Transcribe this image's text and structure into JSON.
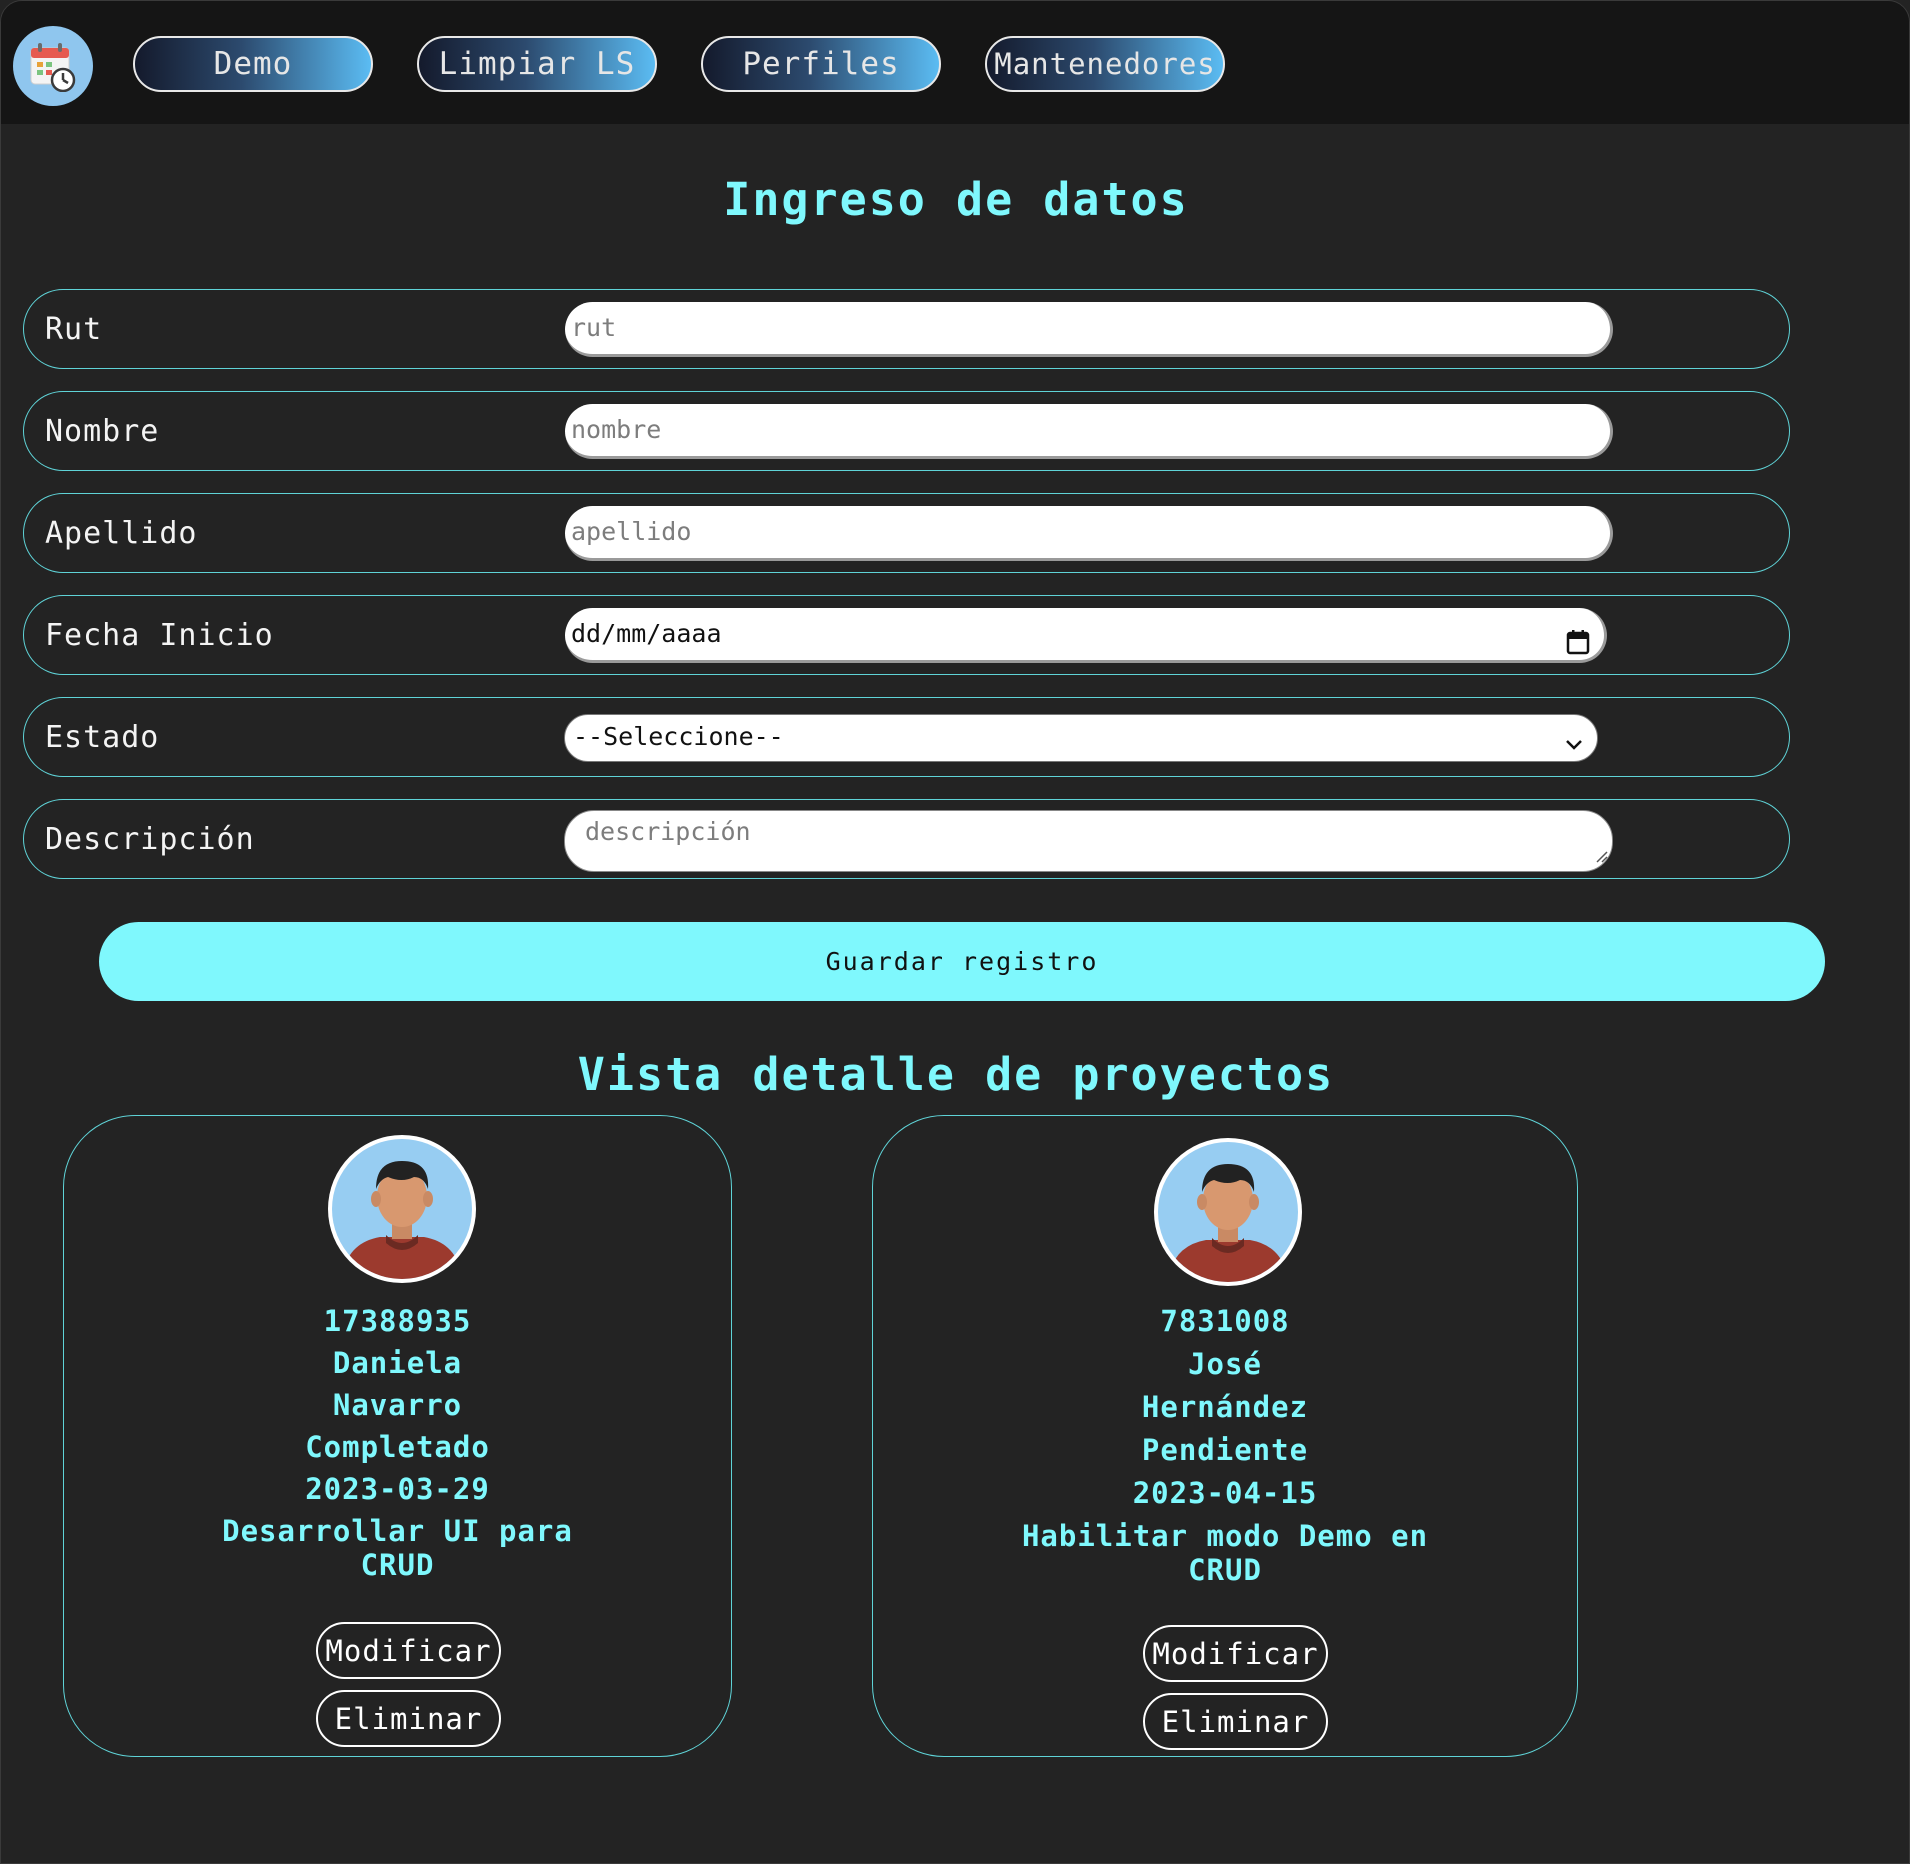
{
  "nav": {
    "items": [
      {
        "label": "Demo"
      },
      {
        "label": "Limpiar LS"
      },
      {
        "label": "Perfiles"
      },
      {
        "label": "Mantenedores"
      }
    ]
  },
  "form": {
    "title": "Ingreso de datos",
    "rut": {
      "label": "Rut",
      "placeholder": "rut"
    },
    "nombre": {
      "label": "Nombre",
      "placeholder": "nombre"
    },
    "apellido": {
      "label": "Apellido",
      "placeholder": "apellido"
    },
    "fecha": {
      "label": "Fecha Inicio",
      "value": "dd/mm/aaaa"
    },
    "estado": {
      "label": "Estado",
      "selected": "--Seleccione--"
    },
    "descripcion": {
      "label": "Descripción",
      "placeholder": "descripción"
    },
    "save_label": "Guardar registro"
  },
  "projects": {
    "title": "Vista detalle de proyectos",
    "cards": [
      {
        "rut": "17388935",
        "nombre": "Daniela",
        "apellido": "Navarro",
        "estado": "Completado",
        "fecha": "2023-03-29",
        "descripcion_l1": "Desarrollar UI para",
        "descripcion_l2": "CRUD",
        "modify_label": "Modificar",
        "delete_label": "Eliminar"
      },
      {
        "rut": "7831008",
        "nombre": "José",
        "apellido": "Hernández",
        "estado": "Pendiente",
        "fecha": "2023-04-15",
        "descripcion_l1": "Habilitar modo Demo en",
        "descripcion_l2": "CRUD",
        "modify_label": "Modificar",
        "delete_label": "Eliminar"
      }
    ]
  },
  "colors": {
    "accent": "#7ff8fd",
    "background": "#232323",
    "navbar": "#151515",
    "border": "#5fd3d7"
  }
}
